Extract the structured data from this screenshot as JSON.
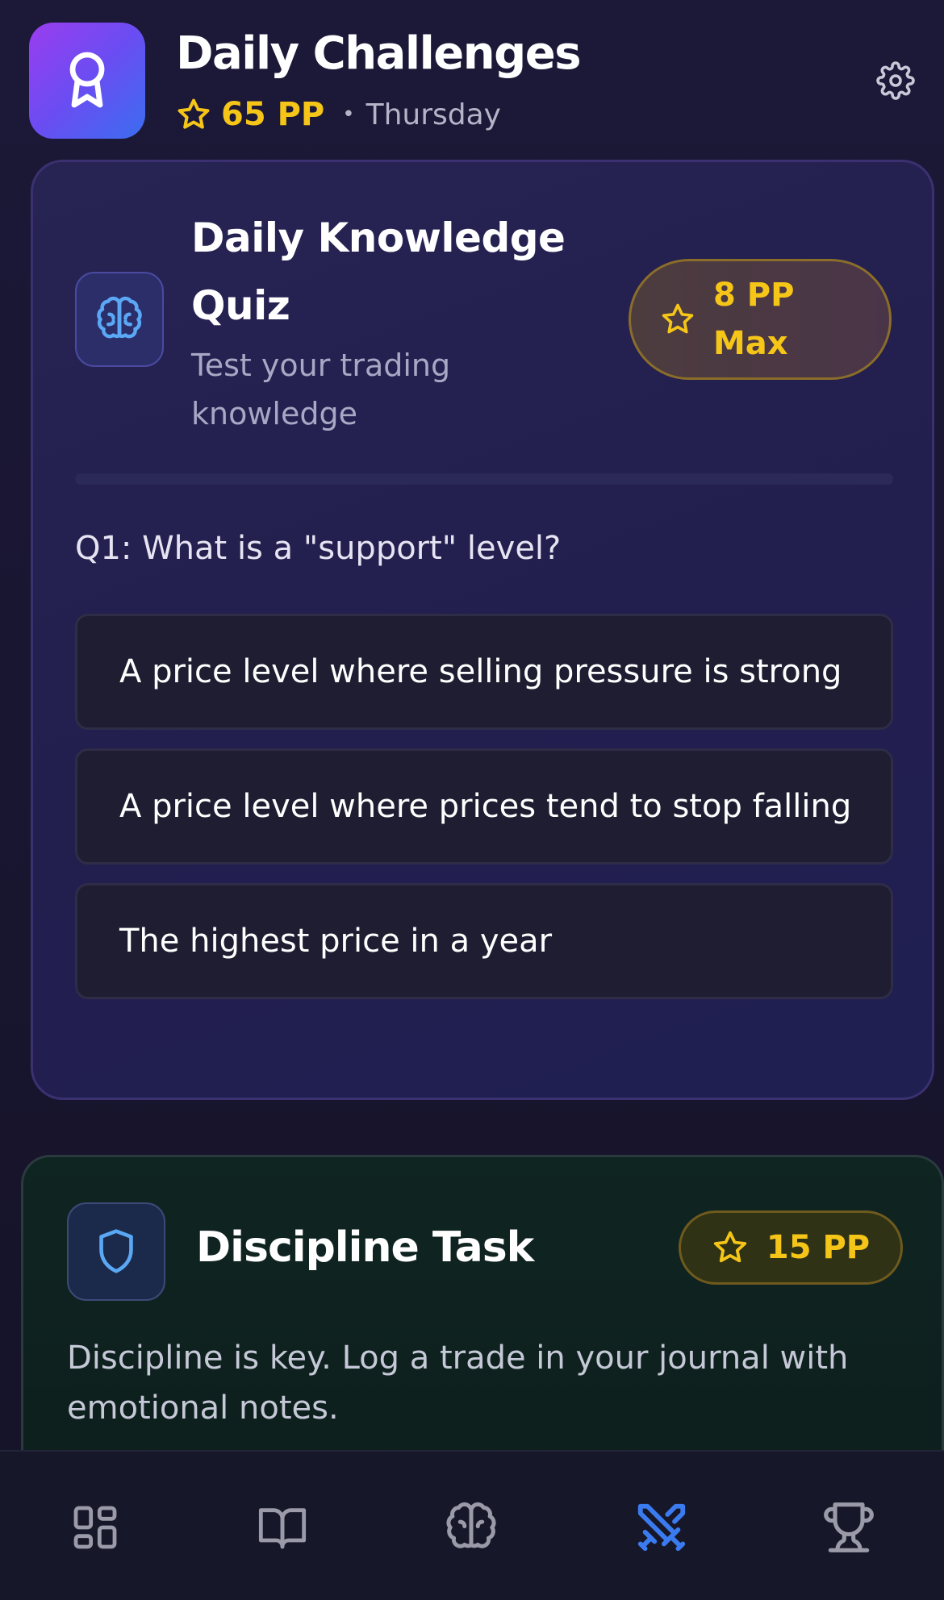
{
  "header": {
    "title": "Daily Challenges",
    "pp_total": "65 PP",
    "separator": "•",
    "day": "Thursday",
    "app_icon": "award-ribbon-icon",
    "settings_icon": "gear-icon"
  },
  "quiz": {
    "title": "Daily Knowledge Quiz",
    "subtitle": "Test your trading knowledge",
    "reward": "8 PP Max",
    "icon": "brain-icon",
    "question": "Q1: What is a \"support\" level?",
    "options": [
      "A price level where selling pressure is strong",
      "A price level where prices tend to stop falling",
      "The highest price in a year"
    ]
  },
  "discipline": {
    "title": "Discipline Task",
    "reward": "15 PP",
    "icon": "shield-icon",
    "description": "Discipline is key. Log a trade in your journal with emotional notes."
  },
  "nav": {
    "items": [
      {
        "icon": "dashboard-icon",
        "active": false
      },
      {
        "icon": "book-icon",
        "active": false
      },
      {
        "icon": "brain-icon",
        "active": false
      },
      {
        "icon": "swords-icon",
        "active": true
      },
      {
        "icon": "trophy-icon",
        "active": false
      }
    ]
  },
  "colors": {
    "accent_gold": "#f5c518",
    "active_nav": "#3b7bf0",
    "inactive_nav": "#9a9aa8"
  }
}
